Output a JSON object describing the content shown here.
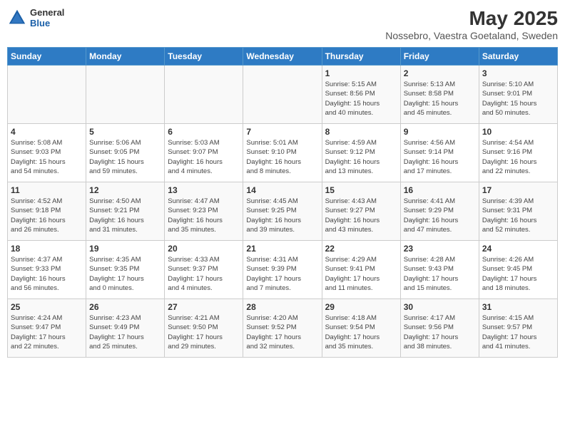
{
  "header": {
    "logo_general": "General",
    "logo_blue": "Blue",
    "month_year": "May 2025",
    "location": "Nossebro, Vaestra Goetaland, Sweden"
  },
  "days_of_week": [
    "Sunday",
    "Monday",
    "Tuesday",
    "Wednesday",
    "Thursday",
    "Friday",
    "Saturday"
  ],
  "weeks": [
    [
      {
        "day": "",
        "info": ""
      },
      {
        "day": "",
        "info": ""
      },
      {
        "day": "",
        "info": ""
      },
      {
        "day": "",
        "info": ""
      },
      {
        "day": "1",
        "info": "Sunrise: 5:15 AM\nSunset: 8:56 PM\nDaylight: 15 hours\nand 40 minutes."
      },
      {
        "day": "2",
        "info": "Sunrise: 5:13 AM\nSunset: 8:58 PM\nDaylight: 15 hours\nand 45 minutes."
      },
      {
        "day": "3",
        "info": "Sunrise: 5:10 AM\nSunset: 9:01 PM\nDaylight: 15 hours\nand 50 minutes."
      }
    ],
    [
      {
        "day": "4",
        "info": "Sunrise: 5:08 AM\nSunset: 9:03 PM\nDaylight: 15 hours\nand 54 minutes."
      },
      {
        "day": "5",
        "info": "Sunrise: 5:06 AM\nSunset: 9:05 PM\nDaylight: 15 hours\nand 59 minutes."
      },
      {
        "day": "6",
        "info": "Sunrise: 5:03 AM\nSunset: 9:07 PM\nDaylight: 16 hours\nand 4 minutes."
      },
      {
        "day": "7",
        "info": "Sunrise: 5:01 AM\nSunset: 9:10 PM\nDaylight: 16 hours\nand 8 minutes."
      },
      {
        "day": "8",
        "info": "Sunrise: 4:59 AM\nSunset: 9:12 PM\nDaylight: 16 hours\nand 13 minutes."
      },
      {
        "day": "9",
        "info": "Sunrise: 4:56 AM\nSunset: 9:14 PM\nDaylight: 16 hours\nand 17 minutes."
      },
      {
        "day": "10",
        "info": "Sunrise: 4:54 AM\nSunset: 9:16 PM\nDaylight: 16 hours\nand 22 minutes."
      }
    ],
    [
      {
        "day": "11",
        "info": "Sunrise: 4:52 AM\nSunset: 9:18 PM\nDaylight: 16 hours\nand 26 minutes."
      },
      {
        "day": "12",
        "info": "Sunrise: 4:50 AM\nSunset: 9:21 PM\nDaylight: 16 hours\nand 31 minutes."
      },
      {
        "day": "13",
        "info": "Sunrise: 4:47 AM\nSunset: 9:23 PM\nDaylight: 16 hours\nand 35 minutes."
      },
      {
        "day": "14",
        "info": "Sunrise: 4:45 AM\nSunset: 9:25 PM\nDaylight: 16 hours\nand 39 minutes."
      },
      {
        "day": "15",
        "info": "Sunrise: 4:43 AM\nSunset: 9:27 PM\nDaylight: 16 hours\nand 43 minutes."
      },
      {
        "day": "16",
        "info": "Sunrise: 4:41 AM\nSunset: 9:29 PM\nDaylight: 16 hours\nand 47 minutes."
      },
      {
        "day": "17",
        "info": "Sunrise: 4:39 AM\nSunset: 9:31 PM\nDaylight: 16 hours\nand 52 minutes."
      }
    ],
    [
      {
        "day": "18",
        "info": "Sunrise: 4:37 AM\nSunset: 9:33 PM\nDaylight: 16 hours\nand 56 minutes."
      },
      {
        "day": "19",
        "info": "Sunrise: 4:35 AM\nSunset: 9:35 PM\nDaylight: 17 hours\nand 0 minutes."
      },
      {
        "day": "20",
        "info": "Sunrise: 4:33 AM\nSunset: 9:37 PM\nDaylight: 17 hours\nand 4 minutes."
      },
      {
        "day": "21",
        "info": "Sunrise: 4:31 AM\nSunset: 9:39 PM\nDaylight: 17 hours\nand 7 minutes."
      },
      {
        "day": "22",
        "info": "Sunrise: 4:29 AM\nSunset: 9:41 PM\nDaylight: 17 hours\nand 11 minutes."
      },
      {
        "day": "23",
        "info": "Sunrise: 4:28 AM\nSunset: 9:43 PM\nDaylight: 17 hours\nand 15 minutes."
      },
      {
        "day": "24",
        "info": "Sunrise: 4:26 AM\nSunset: 9:45 PM\nDaylight: 17 hours\nand 18 minutes."
      }
    ],
    [
      {
        "day": "25",
        "info": "Sunrise: 4:24 AM\nSunset: 9:47 PM\nDaylight: 17 hours\nand 22 minutes."
      },
      {
        "day": "26",
        "info": "Sunrise: 4:23 AM\nSunset: 9:49 PM\nDaylight: 17 hours\nand 25 minutes."
      },
      {
        "day": "27",
        "info": "Sunrise: 4:21 AM\nSunset: 9:50 PM\nDaylight: 17 hours\nand 29 minutes."
      },
      {
        "day": "28",
        "info": "Sunrise: 4:20 AM\nSunset: 9:52 PM\nDaylight: 17 hours\nand 32 minutes."
      },
      {
        "day": "29",
        "info": "Sunrise: 4:18 AM\nSunset: 9:54 PM\nDaylight: 17 hours\nand 35 minutes."
      },
      {
        "day": "30",
        "info": "Sunrise: 4:17 AM\nSunset: 9:56 PM\nDaylight: 17 hours\nand 38 minutes."
      },
      {
        "day": "31",
        "info": "Sunrise: 4:15 AM\nSunset: 9:57 PM\nDaylight: 17 hours\nand 41 minutes."
      }
    ]
  ]
}
